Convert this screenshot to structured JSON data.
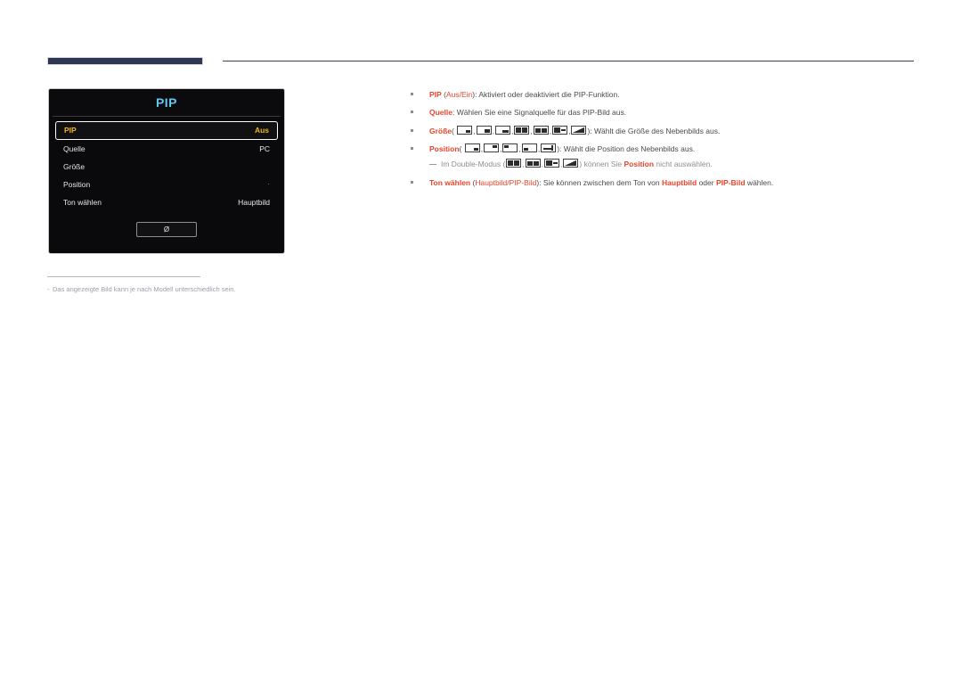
{
  "header": {
    "tab_color": "#2e3652",
    "rule_color": "#3a3f55"
  },
  "osd": {
    "title": "PIP",
    "rows": [
      {
        "label": "PIP",
        "value": "Aus",
        "selected": true,
        "value_style": "text"
      },
      {
        "label": "Quelle",
        "value": "PC",
        "selected": false,
        "value_style": "text"
      },
      {
        "label": "Größe",
        "value": "",
        "selected": false,
        "value_style": "text"
      },
      {
        "label": "Position",
        "value": "·",
        "selected": false,
        "value_style": "dash"
      },
      {
        "label": "Ton wählen",
        "value": "Hauptbild",
        "selected": false,
        "value_style": "text"
      }
    ],
    "button_label": "Ø",
    "title_color": "#63c6ef",
    "selected_color": "#f3b419"
  },
  "footnote": {
    "dash": "-",
    "text": "Das angezeigte Bild kann je nach Modell unterschiedlich sein."
  },
  "doc": {
    "accent_color": "#e8452b",
    "items": [
      {
        "id": "pip",
        "term": "PIP",
        "paren_open": " (",
        "paren_terms": [
          "Aus",
          "/",
          "Ein"
        ],
        "paren_close": ")",
        "desc": ": Aktiviert oder deaktiviert die PIP-Funktion."
      },
      {
        "id": "quelle",
        "term": "Quelle",
        "desc": ": Wählen Sie eine Signalquelle für das PIP-Bild aus."
      },
      {
        "id": "groesse",
        "term": "Größe",
        "icons_label": "( ",
        "icons": [
          "size-small-icon",
          "size-medium-icon",
          "size-large-icon",
          "double-half-icon",
          "double-wide-icon",
          "double-left-icon",
          "double-diagonal-icon"
        ],
        "desc": "): Wählt die Größe des Nebenbilds aus."
      },
      {
        "id": "position",
        "term": "Position",
        "icons_label": "( ",
        "icons": [
          "pos-bottom-right-icon",
          "pos-top-right-icon",
          "pos-top-left-icon",
          "pos-bottom-left-icon",
          "pos-move-icon"
        ],
        "desc": "): Wählt die Position des Nebenbilds aus.",
        "note": {
          "prefix": "Im Double-Modus (",
          "icons": [
            "double-half-icon",
            "double-wide-icon",
            "double-left-icon",
            "double-diagonal-icon"
          ],
          "middle": ") können Sie ",
          "term": "Position",
          "suffix": " nicht auswählen."
        }
      },
      {
        "id": "ton-waehlen",
        "term": "Ton wählen",
        "paren_open": " (",
        "paren_terms": [
          "Hauptbild",
          "/",
          "PIP-Bild"
        ],
        "paren_close": ")",
        "desc": ": Sie können zwischen dem Ton von ",
        "desc_term1": "Hauptbild",
        "desc_mid": " oder ",
        "desc_term2": "PIP-Bild",
        "desc_end": " wählen."
      }
    ]
  }
}
